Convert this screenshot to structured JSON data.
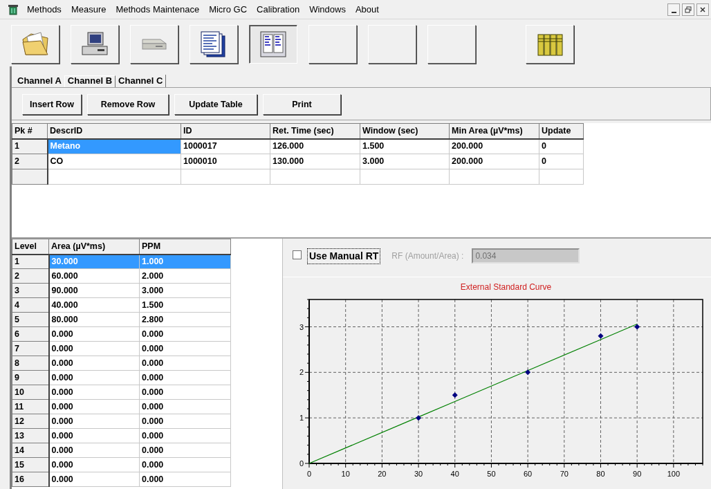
{
  "menu": [
    "Methods",
    "Measure",
    "Methods Maintenace",
    "Micro GC",
    "Calibration",
    "Windows",
    "About"
  ],
  "toolbar": [
    {
      "kind": "folder",
      "pressed": false
    },
    {
      "kind": "computer",
      "pressed": false
    },
    {
      "kind": "device",
      "pressed": false
    },
    {
      "kind": "documents",
      "pressed": false
    },
    {
      "kind": "table",
      "pressed": true
    },
    {
      "kind": "blank",
      "pressed": false
    },
    {
      "kind": "blank",
      "pressed": false
    },
    {
      "kind": "blank",
      "pressed": false
    },
    {
      "kind": "books",
      "pressed": false
    }
  ],
  "tabs": [
    {
      "label": "Channel A",
      "selected": false
    },
    {
      "label": "Channel B",
      "selected": true
    },
    {
      "label": "Channel C",
      "selected": false
    }
  ],
  "buttons": [
    "Insert Row",
    "Remove Row",
    "Update Table",
    "Print"
  ],
  "peak_table": {
    "columns": [
      "Pk #",
      "DescrID",
      "ID",
      "Ret. Time (sec)",
      "Window (sec)",
      "Min Area (µV*ms)",
      "Update"
    ],
    "rows": [
      {
        "selected": true,
        "cells": [
          "1",
          "Metano",
          "1000017",
          "126.000",
          "1.500",
          "200.000",
          "0"
        ]
      },
      {
        "selected": false,
        "cells": [
          "2",
          "CO",
          "1000010",
          "130.000",
          "3.000",
          "200.000",
          "0"
        ]
      }
    ]
  },
  "level_table": {
    "columns": [
      "Level",
      "Area (µV*ms)",
      "PPM"
    ],
    "rows": [
      {
        "selected": true,
        "cells": [
          "1",
          "30.000",
          "1.000"
        ]
      },
      {
        "selected": false,
        "cells": [
          "2",
          "60.000",
          "2.000"
        ]
      },
      {
        "selected": false,
        "cells": [
          "3",
          "90.000",
          "3.000"
        ]
      },
      {
        "selected": false,
        "cells": [
          "4",
          "40.000",
          "1.500"
        ]
      },
      {
        "selected": false,
        "cells": [
          "5",
          "80.000",
          "2.800"
        ]
      },
      {
        "selected": false,
        "cells": [
          "6",
          "0.000",
          "0.000"
        ]
      },
      {
        "selected": false,
        "cells": [
          "7",
          "0.000",
          "0.000"
        ]
      },
      {
        "selected": false,
        "cells": [
          "8",
          "0.000",
          "0.000"
        ]
      },
      {
        "selected": false,
        "cells": [
          "9",
          "0.000",
          "0.000"
        ]
      },
      {
        "selected": false,
        "cells": [
          "10",
          "0.000",
          "0.000"
        ]
      },
      {
        "selected": false,
        "cells": [
          "11",
          "0.000",
          "0.000"
        ]
      },
      {
        "selected": false,
        "cells": [
          "12",
          "0.000",
          "0.000"
        ]
      },
      {
        "selected": false,
        "cells": [
          "13",
          "0.000",
          "0.000"
        ]
      },
      {
        "selected": false,
        "cells": [
          "14",
          "0.000",
          "0.000"
        ]
      },
      {
        "selected": false,
        "cells": [
          "15",
          "0.000",
          "0.000"
        ]
      },
      {
        "selected": false,
        "cells": [
          "16",
          "0.000",
          "0.000"
        ]
      }
    ]
  },
  "manual_rt": {
    "label": "Use Manual RT",
    "checked": false
  },
  "rf_field": {
    "label": "RF (Amount/Area) :",
    "value": "0.034",
    "disabled": true
  },
  "chart": {
    "chart_data": {
      "type": "scatter",
      "title": "External Standard Curve",
      "x": [
        0,
        30,
        40,
        60,
        80,
        90
      ],
      "series": [
        {
          "color": "#000080",
          "values": [
            null,
            1,
            1.5,
            2,
            2.8,
            3
          ]
        },
        {
          "type": "line",
          "color": "#008000",
          "values": [
            0,
            1.02,
            1.36,
            2.04,
            2.72,
            3.06
          ]
        }
      ],
      "grid": true,
      "xlim": [
        0,
        108
      ],
      "ylim": [
        0,
        3.6
      ],
      "xticks": [
        0,
        10,
        20,
        30,
        40,
        50,
        60,
        70,
        80,
        90,
        100
      ],
      "yticks": [
        0,
        1,
        2,
        3
      ]
    }
  }
}
